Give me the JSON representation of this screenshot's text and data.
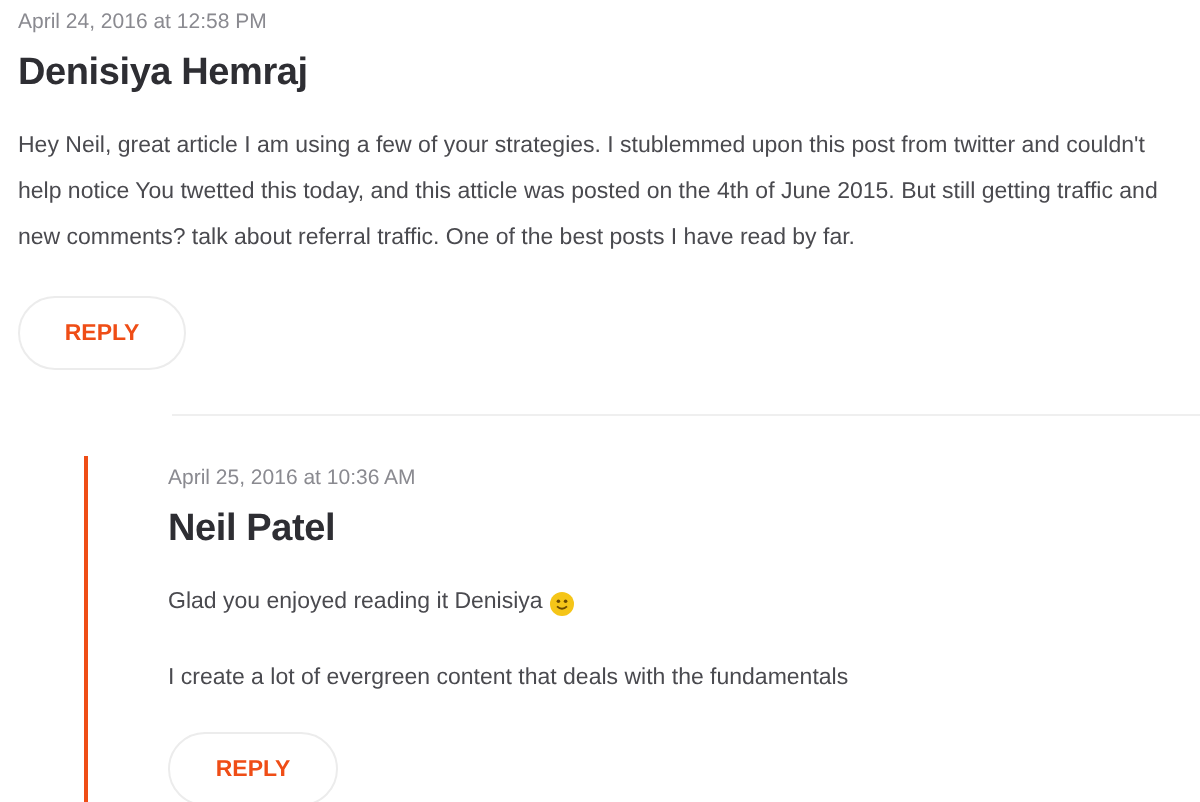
{
  "comments": [
    {
      "date": "April 24, 2016 at 12:58 PM",
      "author": "Denisiya Hemraj",
      "paragraphs": [
        {
          "text": "Hey Neil, great article I am using a few of your strategies. I stublemmed upon this post from twitter and couldn't help notice You twetted this today, and this atticle was posted on the 4th of June 2015. But still getting traffic and new comments? talk about referral traffic. One of the best posts I have read by far.",
          "smiley": false
        }
      ],
      "reply_label": "REPLY",
      "children": [
        {
          "date": "April 25, 2016 at 10:36 AM",
          "author": "Neil Patel",
          "paragraphs": [
            {
              "text": "Glad you enjoyed reading it Denisiya",
              "smiley": true
            },
            {
              "text": "I create a lot of evergreen content that deals with the fundamentals",
              "smiley": false
            }
          ],
          "reply_label": "REPLY"
        }
      ]
    }
  ]
}
